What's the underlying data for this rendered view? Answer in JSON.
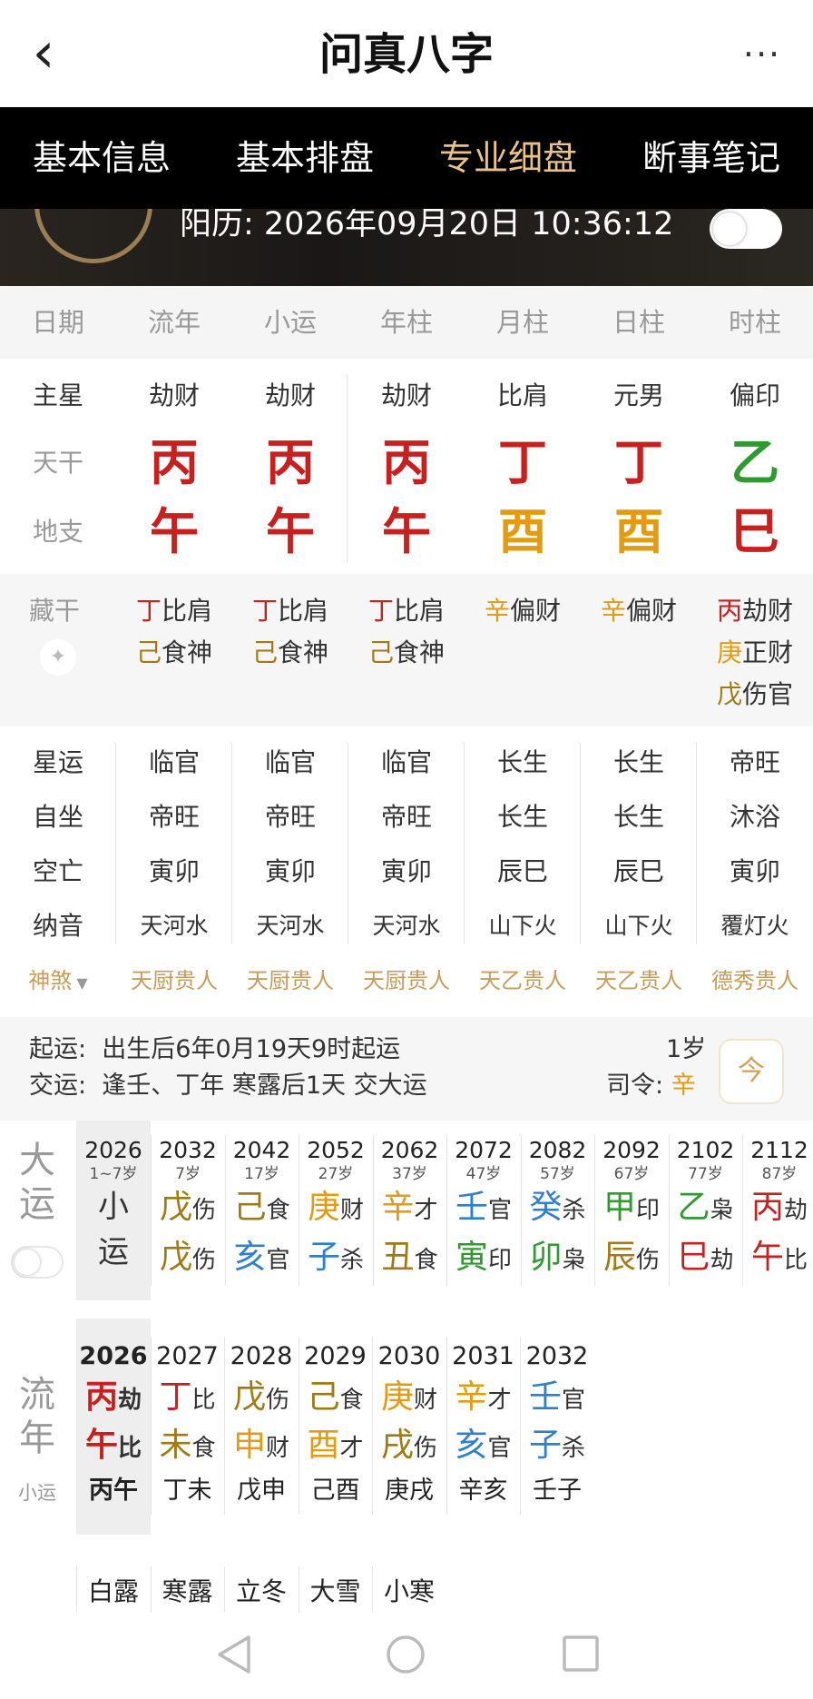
{
  "app": {
    "title": "问真八字",
    "back": "‹",
    "more": "···"
  },
  "tabs": [
    "基本信息",
    "基本排盘",
    "专业细盘",
    "断事笔记"
  ],
  "header": {
    "solar_label": "阳历: 2026年09月20日 10:36:12"
  },
  "columns": [
    "日期",
    "流年",
    "小运",
    "年柱",
    "月柱",
    "日柱",
    "时柱"
  ],
  "labels": {
    "zhuxing": "主星",
    "tiangan": "天干",
    "dizhi": "地支",
    "canggan": "藏干",
    "xingyun": "星运",
    "zizuo": "自坐",
    "kongwang": "空亡",
    "nayin": "纳音",
    "shensha": "神煞"
  },
  "pillars": {
    "zhuxing": [
      "劫财",
      "劫财",
      "劫财",
      "比肩",
      "元男",
      "偏印"
    ],
    "tiangan": [
      "丙",
      "丙",
      "丙",
      "丁",
      "丁",
      "乙"
    ],
    "dizhi": [
      "午",
      "午",
      "午",
      "酉",
      "酉",
      "巳"
    ],
    "tiangan_colors": [
      "#c8201e",
      "#c8201e",
      "#c8201e",
      "#c8201e",
      "#c8201e",
      "#2f9a2f"
    ],
    "dizhi_colors": [
      "#c8201e",
      "#c8201e",
      "#c8201e",
      "#e39b12",
      "#e39b12",
      "#c8201e"
    ]
  },
  "canggan": [
    [
      {
        "g": "丁",
        "s": "比肩",
        "c": "#c8201e"
      },
      {
        "g": "己",
        "s": "食神",
        "c": "#a07a12"
      }
    ],
    [
      {
        "g": "丁",
        "s": "比肩",
        "c": "#c8201e"
      },
      {
        "g": "己",
        "s": "食神",
        "c": "#a07a12"
      }
    ],
    [
      {
        "g": "丁",
        "s": "比肩",
        "c": "#c8201e"
      },
      {
        "g": "己",
        "s": "食神",
        "c": "#a07a12"
      }
    ],
    [
      {
        "g": "辛",
        "s": "偏财",
        "c": "#e39b12"
      }
    ],
    [
      {
        "g": "辛",
        "s": "偏财",
        "c": "#e39b12"
      }
    ],
    [
      {
        "g": "丙",
        "s": "劫财",
        "c": "#c8201e"
      },
      {
        "g": "庚",
        "s": "正财",
        "c": "#e39b12"
      },
      {
        "g": "戊",
        "s": "伤官",
        "c": "#a07a12"
      }
    ]
  ],
  "xingyun": [
    "临官",
    "临官",
    "临官",
    "长生",
    "长生",
    "帝旺"
  ],
  "zizuo": [
    "帝旺",
    "帝旺",
    "帝旺",
    "长生",
    "长生",
    "沐浴"
  ],
  "kongwang": [
    "寅卯",
    "寅卯",
    "寅卯",
    "辰巳",
    "辰巳",
    "寅卯"
  ],
  "nayin": [
    "天河水",
    "天河水",
    "天河水",
    "山下火",
    "山下火",
    "覆灯火"
  ],
  "shensha": [
    "天厨贵人",
    "天厨贵人",
    "天厨贵人",
    "天乙贵人",
    "天乙贵人",
    "德秀贵人"
  ],
  "qiyun": {
    "qiyun_label": "起运:",
    "qiyun_text": "出生后6年0月19天9时起运",
    "jiaoyun_label": "交运:",
    "jiaoyun_text": "逢壬、丁年 寒露后1天 交大运",
    "age": "1岁",
    "siling_label": "司令:",
    "siling_value": "辛",
    "cal_icon": "今"
  },
  "dayun": {
    "label1": "大",
    "label2": "运",
    "first": {
      "year": "2026",
      "age": "1~7岁",
      "t1": "小",
      "t2": "运"
    },
    "items": [
      {
        "year": "2032",
        "age": "7岁",
        "g": "戊",
        "gs": "伤",
        "gc": "#a07a12",
        "z": "戊",
        "zs": "伤",
        "zc": "#a07a12"
      },
      {
        "year": "2042",
        "age": "17岁",
        "g": "己",
        "gs": "食",
        "gc": "#a07a12",
        "z": "亥",
        "zs": "官",
        "zc": "#2f7fd0"
      },
      {
        "year": "2052",
        "age": "27岁",
        "g": "庚",
        "gs": "财",
        "gc": "#e39b12",
        "z": "子",
        "zs": "杀",
        "zc": "#2f7fd0"
      },
      {
        "year": "2062",
        "age": "37岁",
        "g": "辛",
        "gs": "才",
        "gc": "#e39b12",
        "z": "丑",
        "zs": "食",
        "zc": "#a07a12"
      },
      {
        "year": "2072",
        "age": "47岁",
        "g": "壬",
        "gs": "官",
        "gc": "#2f7fd0",
        "z": "寅",
        "zs": "印",
        "zc": "#2f9a2f"
      },
      {
        "year": "2082",
        "age": "57岁",
        "g": "癸",
        "gs": "杀",
        "gc": "#2f7fd0",
        "z": "卯",
        "zs": "枭",
        "zc": "#2f9a2f"
      },
      {
        "year": "2092",
        "age": "67岁",
        "g": "甲",
        "gs": "印",
        "gc": "#2f9a2f",
        "z": "辰",
        "zs": "伤",
        "zc": "#a07a12"
      },
      {
        "year": "2102",
        "age": "77岁",
        "g": "乙",
        "gs": "枭",
        "gc": "#2f9a2f",
        "z": "巳",
        "zs": "劫",
        "zc": "#c8201e"
      },
      {
        "year": "2112",
        "age": "87岁",
        "g": "丙",
        "gs": "劫",
        "gc": "#c8201e",
        "z": "午",
        "zs": "比",
        "zc": "#c8201e"
      }
    ]
  },
  "liunian": {
    "label1": "流",
    "label2": "年",
    "sublabel": "小运",
    "items": [
      {
        "year": "2026",
        "g": "丙",
        "gs": "劫",
        "gc": "#c8201e",
        "z": "午",
        "zs": "比",
        "zc": "#c8201e",
        "gz": "丙午",
        "active": true
      },
      {
        "year": "2027",
        "g": "丁",
        "gs": "比",
        "gc": "#c8201e",
        "z": "未",
        "zs": "食",
        "zc": "#a07a12",
        "gz": "丁未"
      },
      {
        "year": "2028",
        "g": "戊",
        "gs": "伤",
        "gc": "#a07a12",
        "z": "申",
        "zs": "财",
        "zc": "#e39b12",
        "gz": "戊申"
      },
      {
        "year": "2029",
        "g": "己",
        "gs": "食",
        "gc": "#a07a12",
        "z": "酉",
        "zs": "才",
        "zc": "#e39b12",
        "gz": "己酉"
      },
      {
        "year": "2030",
        "g": "庚",
        "gs": "财",
        "gc": "#e39b12",
        "z": "戌",
        "zs": "伤",
        "zc": "#a07a12",
        "gz": "庚戌"
      },
      {
        "year": "2031",
        "g": "辛",
        "gs": "才",
        "gc": "#e39b12",
        "z": "亥",
        "zs": "官",
        "zc": "#2f7fd0",
        "gz": "辛亥"
      },
      {
        "year": "2032",
        "g": "壬",
        "gs": "官",
        "gc": "#2f7fd0",
        "z": "子",
        "zs": "杀",
        "zc": "#2f7fd0",
        "gz": "壬子"
      }
    ]
  },
  "jieqi": [
    "白露",
    "寒露",
    "立冬",
    "大雪",
    "小寒"
  ]
}
